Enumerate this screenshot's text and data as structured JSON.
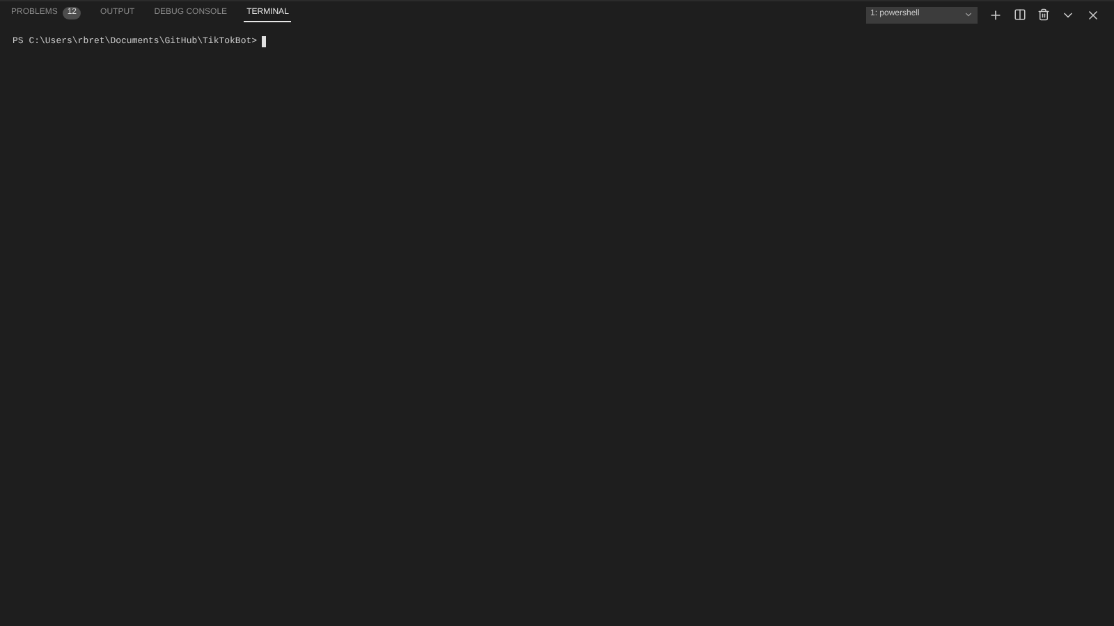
{
  "tabs": [
    {
      "label": "PROBLEMS",
      "badge": "12",
      "selected": false
    },
    {
      "label": "OUTPUT",
      "selected": false
    },
    {
      "label": "DEBUG CONSOLE",
      "selected": false
    },
    {
      "label": "TERMINAL",
      "selected": true
    }
  ],
  "terminal_select": {
    "value": "1: powershell"
  },
  "terminal": {
    "prompt": "PS C:\\Users\\rbret\\Documents\\GitHub\\TikTokBot>"
  }
}
